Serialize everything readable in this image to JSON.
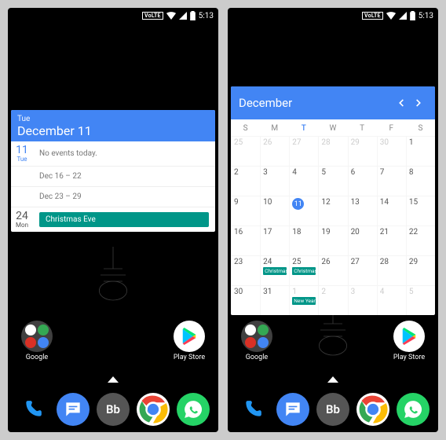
{
  "status": {
    "volte": "VoLTE",
    "time": "5:13"
  },
  "agenda": {
    "header_dow": "Tue",
    "header_date": "December 11",
    "rows": [
      {
        "num": "11",
        "dow": "Tue",
        "blue": true,
        "text": "No events today.",
        "event": false
      },
      {
        "num": "",
        "dow": "",
        "blue": false,
        "text": "Dec 16 – 22",
        "event": false
      },
      {
        "num": "",
        "dow": "",
        "blue": false,
        "text": "Dec 23 – 29",
        "event": false
      },
      {
        "num": "24",
        "dow": "Mon",
        "blue": false,
        "text": "Christmas Eve",
        "event": true
      }
    ]
  },
  "month": {
    "title": "December",
    "dow": [
      "S",
      "M",
      "T",
      "W",
      "T",
      "F",
      "S"
    ],
    "today_dow_index": 2,
    "weeks": [
      [
        {
          "n": "25",
          "out": true
        },
        {
          "n": "26",
          "out": true
        },
        {
          "n": "27",
          "out": true
        },
        {
          "n": "28",
          "out": true
        },
        {
          "n": "29",
          "out": true
        },
        {
          "n": "30",
          "out": true
        },
        {
          "n": "1"
        }
      ],
      [
        {
          "n": "2"
        },
        {
          "n": "3"
        },
        {
          "n": "4"
        },
        {
          "n": "5"
        },
        {
          "n": "6"
        },
        {
          "n": "7"
        },
        {
          "n": "8"
        }
      ],
      [
        {
          "n": "9"
        },
        {
          "n": "10"
        },
        {
          "n": "11",
          "today": true
        },
        {
          "n": "12"
        },
        {
          "n": "13"
        },
        {
          "n": "14"
        },
        {
          "n": "15"
        }
      ],
      [
        {
          "n": "16"
        },
        {
          "n": "17"
        },
        {
          "n": "18"
        },
        {
          "n": "19"
        },
        {
          "n": "20"
        },
        {
          "n": "21"
        },
        {
          "n": "22"
        }
      ],
      [
        {
          "n": "23"
        },
        {
          "n": "24",
          "ev": "Christmas"
        },
        {
          "n": "25",
          "ev": "Christmas"
        },
        {
          "n": "26"
        },
        {
          "n": "27"
        },
        {
          "n": "28"
        },
        {
          "n": "29"
        }
      ],
      [
        {
          "n": "30"
        },
        {
          "n": "31"
        },
        {
          "n": "1",
          "out": true,
          "ev": "New Year"
        },
        {
          "n": "2",
          "out": true
        },
        {
          "n": "3",
          "out": true
        },
        {
          "n": "4",
          "out": true
        },
        {
          "n": "5",
          "out": true
        }
      ]
    ]
  },
  "home": {
    "folder_label": "Google",
    "play_label": "Play Store",
    "dock_bb": "Bb"
  }
}
